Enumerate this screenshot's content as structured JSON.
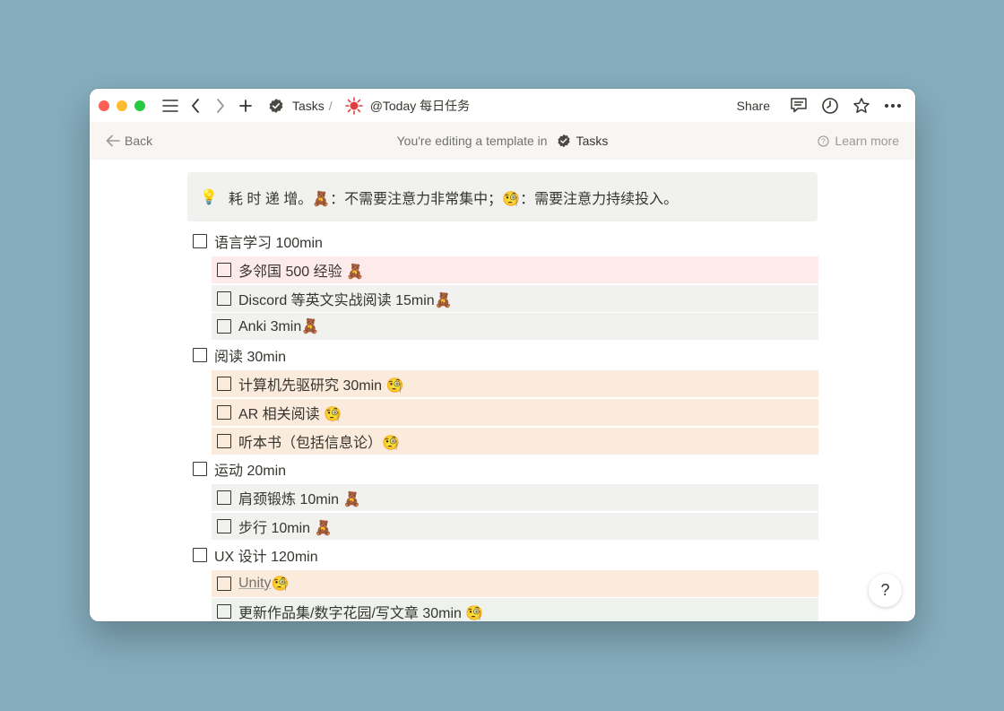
{
  "titlebar": {
    "breadcrumb_parent": "Tasks",
    "breadcrumb_sep": "/",
    "page_title": "@Today 每日任务",
    "share_label": "Share"
  },
  "template_bar": {
    "back_label": "Back",
    "editing_label": "You're editing a template in",
    "editing_target": "Tasks",
    "learn_more_label": "Learn more"
  },
  "callout": {
    "icon": "💡",
    "text": "耗 时 递 增。🧸：不需要注意力非常集中；🧐：需要注意力持续投入。"
  },
  "tasks": [
    {
      "level": 1,
      "text": "语言学习 100min",
      "bg": "none"
    },
    {
      "level": 2,
      "text": "多邻国 500 经验 🧸",
      "bg": "red"
    },
    {
      "level": 2,
      "text": "Discord 等英文实战阅读 15min🧸",
      "bg": "gray"
    },
    {
      "level": 2,
      "text": "Anki 3min🧸",
      "bg": "gray"
    },
    {
      "level": 1,
      "text": "阅读 30min",
      "bg": "none"
    },
    {
      "level": 2,
      "text": "计算机先驱研究 30min 🧐",
      "bg": "orange"
    },
    {
      "level": 2,
      "text": "AR 相关阅读 🧐",
      "bg": "orange"
    },
    {
      "level": 2,
      "text": "听本书（包括信息论）🧐",
      "bg": "orange"
    },
    {
      "level": 1,
      "text": "运动 20min",
      "bg": "none"
    },
    {
      "level": 2,
      "text": "肩颈锻炼 10min 🧸",
      "bg": "gray"
    },
    {
      "level": 2,
      "text": "步行 10min 🧸",
      "bg": "gray"
    },
    {
      "level": 1,
      "text": "UX 设计 120min",
      "bg": "none"
    },
    {
      "level": 2,
      "text": "Unity",
      "suffix": " 🧐",
      "bg": "orange",
      "link": true
    },
    {
      "level": 2,
      "text": "更新作品集/数字花园/写文章 30min 🧐",
      "bg": "green"
    }
  ],
  "help_label": "?",
  "colors": {
    "desktop": "#85adbd",
    "bg_red": "#fdebec",
    "bg_gray": "#f1f1ef",
    "bg_orange": "#faebdd",
    "bg_green": "#edf3ec"
  }
}
